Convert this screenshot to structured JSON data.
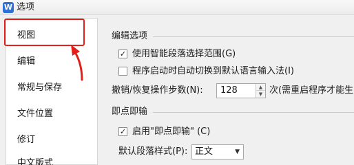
{
  "window": {
    "app_icon": "W",
    "title": "选项"
  },
  "sidebar": {
    "items": [
      {
        "label": "视图"
      },
      {
        "label": "编辑"
      },
      {
        "label": "常规与保存"
      },
      {
        "label": "文件位置"
      },
      {
        "label": "修订"
      },
      {
        "label": "中文版式"
      }
    ]
  },
  "edit_options": {
    "section_title": "编辑选项",
    "smart_paragraph": {
      "label": "使用智能段落选择范围(G)",
      "checked": true,
      "mark": "✓"
    },
    "auto_ime": {
      "label": "程序启动时自动切换到默认语言输入法(I)",
      "checked": false
    },
    "undo_steps": {
      "label": "撤销/恢复操作步数(N):",
      "value": "128",
      "note": "次(需重启程序才能生"
    }
  },
  "click_and_type": {
    "section_title": "即点即输",
    "enable": {
      "label": "启用\"即点即输\" (C)",
      "checked": true,
      "mark": "✓"
    },
    "default_style": {
      "label": "默认段落样式(P):",
      "value": "正文"
    }
  },
  "annotation": {
    "highlight_color": "#e0211b"
  },
  "icons": [
    "app-logo-icon",
    "check-icon",
    "spin-up-icon",
    "spin-down-icon",
    "dropdown-arrow-icon",
    "red-arrow-annotation"
  ]
}
